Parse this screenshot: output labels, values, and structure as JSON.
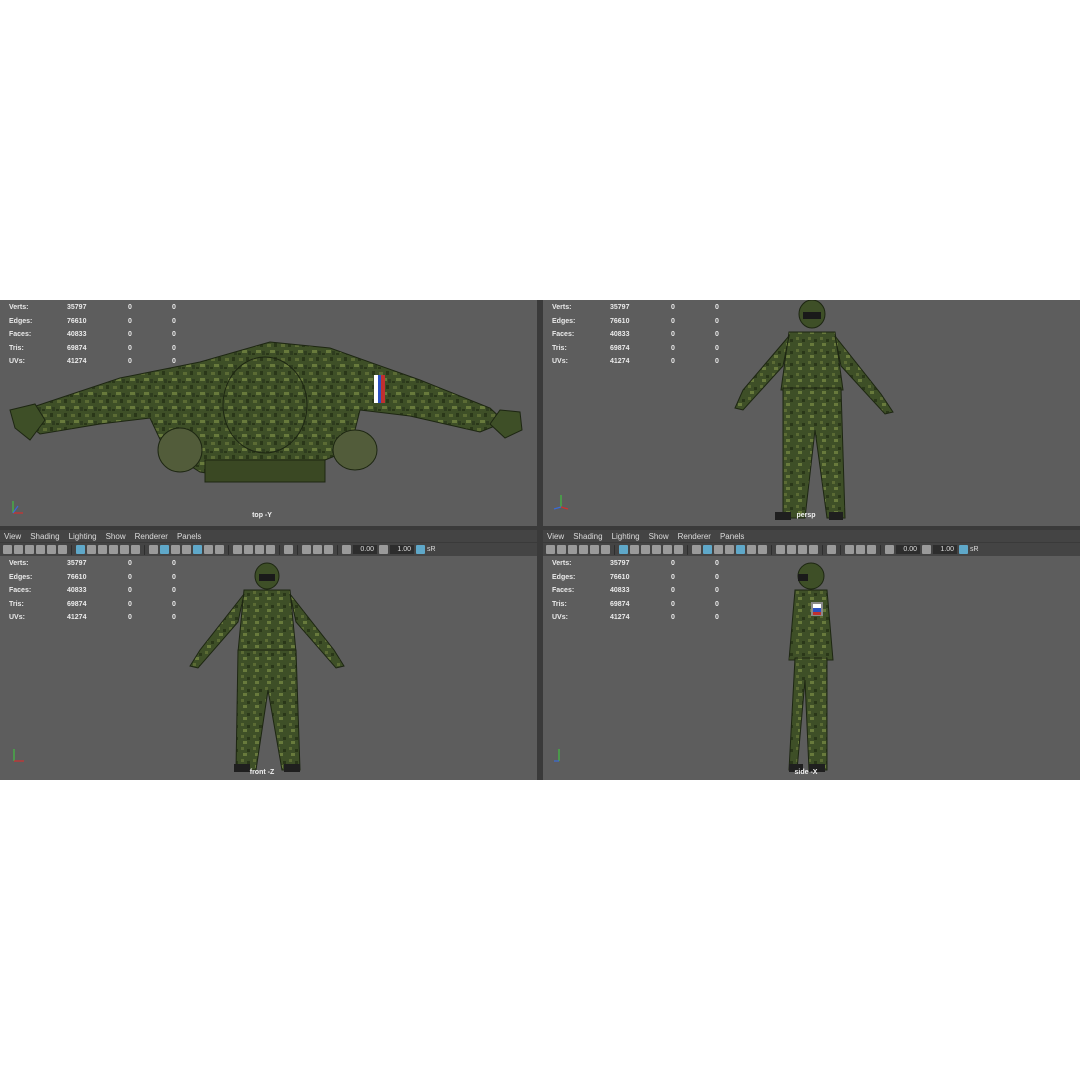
{
  "stats_labels": {
    "verts": "Verts:",
    "edges": "Edges:",
    "faces": "Faces:",
    "tris": "Tris:",
    "uvs": "UVs:"
  },
  "stats_values": {
    "verts": "35797",
    "edges": "76610",
    "faces": "40833",
    "tris": "69874",
    "uvs": "41274",
    "zero": "0"
  },
  "menu": {
    "view": "View",
    "shading": "Shading",
    "lighting": "Lighting",
    "show": "Show",
    "renderer": "Renderer",
    "panels": "Panels"
  },
  "toolbar": {
    "value_a": "0.00",
    "value_b": "1.00",
    "cut_label": "sR"
  },
  "viewports": {
    "top": {
      "camera": "top -Y"
    },
    "persp": {
      "camera": "persp"
    },
    "front": {
      "camera": "front -Z"
    },
    "side": {
      "camera": "side -X"
    }
  },
  "colors": {
    "viewport_bg": "#5d5d5d",
    "camo_dark": "#2f3d1f",
    "camo_mid": "#4a5c2e",
    "camo_light": "#6b7a3e",
    "axis_x": "#d03030",
    "axis_y": "#40c040",
    "axis_z": "#3a6bd8"
  },
  "icons": [
    "camera-icon",
    "grid-icon",
    "shaded-icon",
    "wireframe-icon",
    "light-icon",
    "exposure-icon",
    "gamma-icon",
    "settings-icon"
  ]
}
